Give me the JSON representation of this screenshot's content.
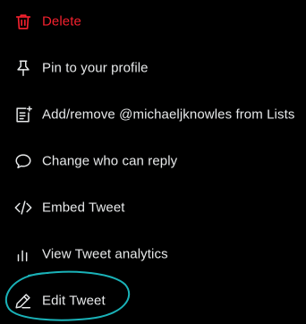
{
  "menu": {
    "items": [
      {
        "label": "Delete",
        "icon": "trash-icon",
        "danger": true
      },
      {
        "label": "Pin to your profile",
        "icon": "pin-icon",
        "danger": false
      },
      {
        "label": "Add/remove @michaeljknowles from Lists",
        "icon": "list-add-icon",
        "danger": false
      },
      {
        "label": "Change who can reply",
        "icon": "reply-bubble-icon",
        "danger": false
      },
      {
        "label": "Embed Tweet",
        "icon": "code-icon",
        "danger": false
      },
      {
        "label": "View Tweet analytics",
        "icon": "analytics-icon",
        "danger": false
      },
      {
        "label": "Edit Tweet",
        "icon": "pencil-icon",
        "danger": false
      }
    ]
  },
  "colors": {
    "background": "#000000",
    "text": "#e7e9ea",
    "danger": "#f4212e",
    "icon": "#e7e9ea",
    "annotation": "#1ab2b8"
  }
}
